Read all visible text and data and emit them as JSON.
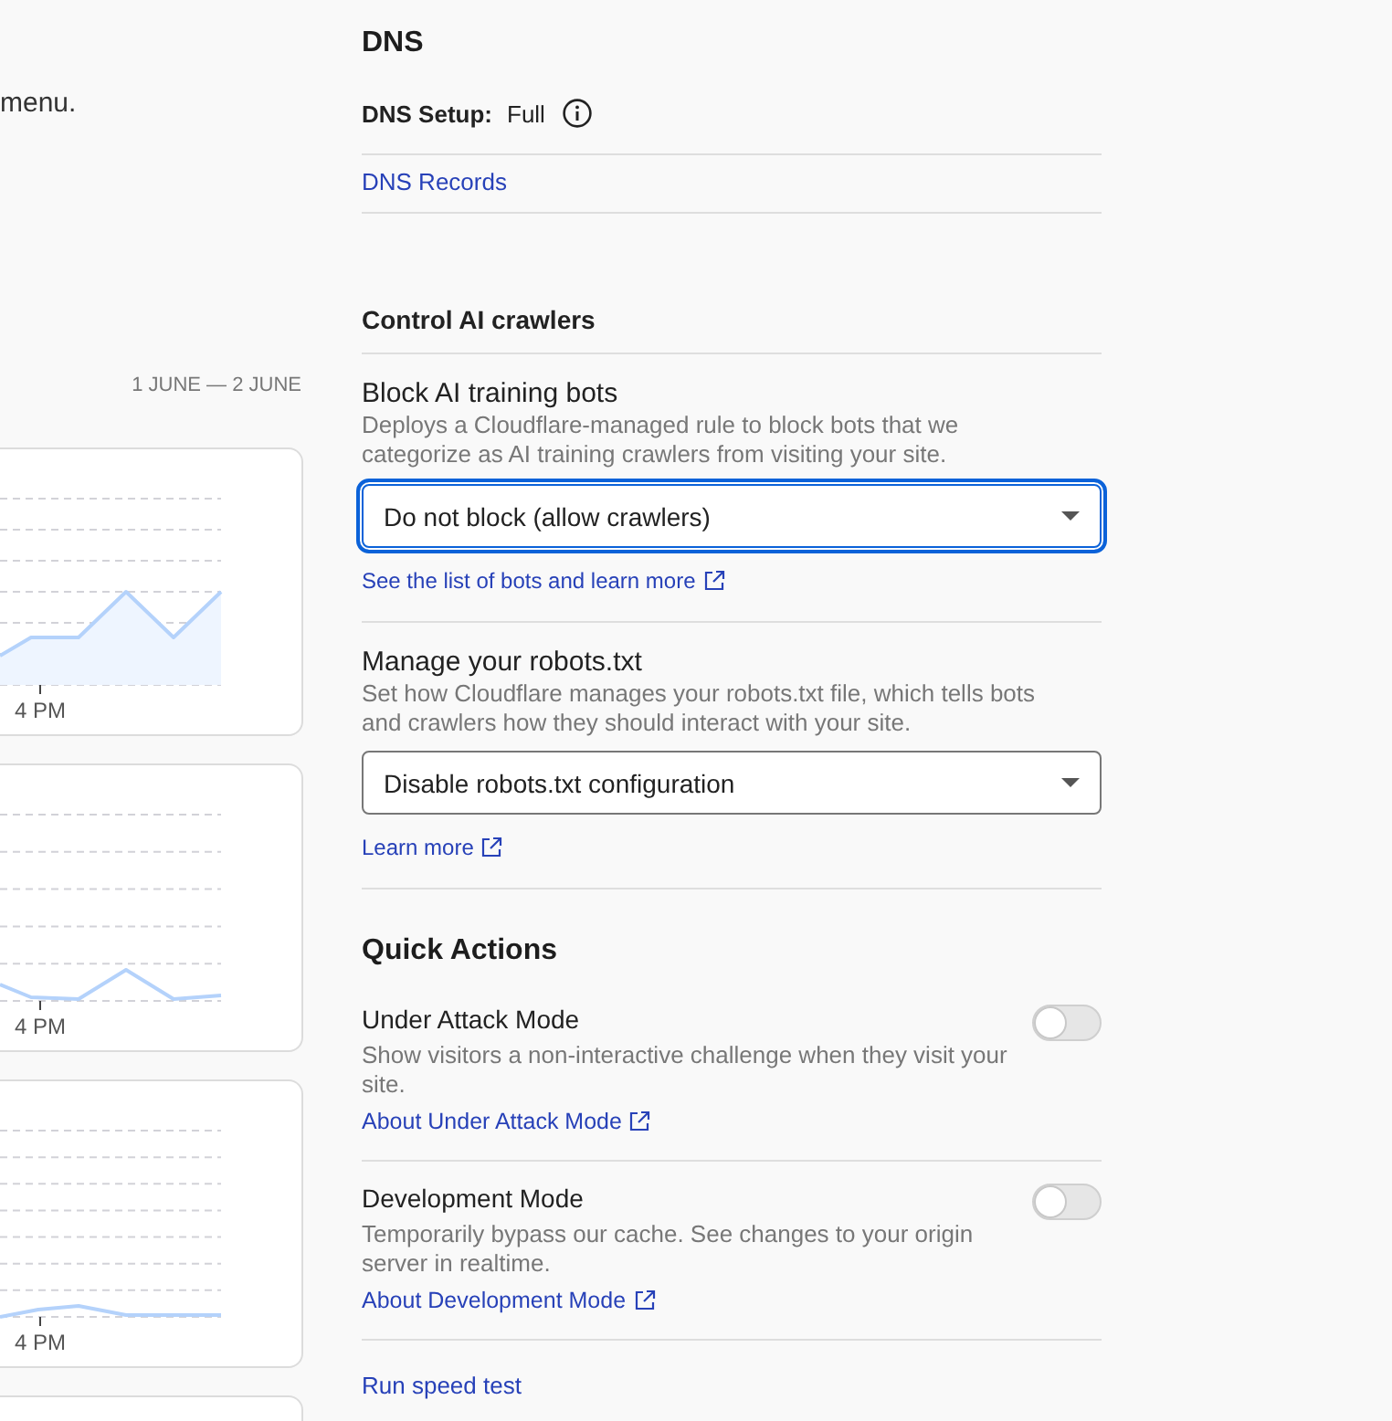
{
  "left_panel": {
    "intro_text_fragment": "menu.",
    "date_range": "1 JUNE — 2 JUNE",
    "charts": [
      {
        "tick_label": "4 PM"
      },
      {
        "tick_label": "4 PM"
      },
      {
        "tick_label": "4 PM"
      }
    ]
  },
  "dns": {
    "title": "DNS",
    "setup_label": "DNS Setup:",
    "setup_value": "Full",
    "records_link": "DNS Records"
  },
  "ai_crawlers": {
    "title": "Control AI crawlers",
    "settings": [
      {
        "title": "Block AI training bots",
        "description": "Deploys a Cloudflare-managed rule to block bots that we categorize as AI training crawlers from visiting your site.",
        "dropdown": {
          "value": "Do not block (allow crawlers)",
          "focused": true
        },
        "link": "See the list of bots and learn more"
      },
      {
        "title": "Manage your robots.txt",
        "description": "Set how Cloudflare manages your robots.txt file, which tells bots and crawlers how they should interact with your site.",
        "dropdown": {
          "value": "Disable robots.txt configuration",
          "focused": false
        },
        "link": "Learn more"
      }
    ]
  },
  "quick_actions": {
    "title": "Quick Actions",
    "items": [
      {
        "title": "Under Attack Mode",
        "description": "Show visitors a non-interactive challenge when they visit your site.",
        "link": "About Under Attack Mode",
        "on": false
      },
      {
        "title": "Development Mode",
        "description": "Temporarily bypass our cache. See changes to your origin server in realtime.",
        "link": "About Development Mode",
        "on": false
      }
    ],
    "speed_test_link": "Run speed test"
  }
}
